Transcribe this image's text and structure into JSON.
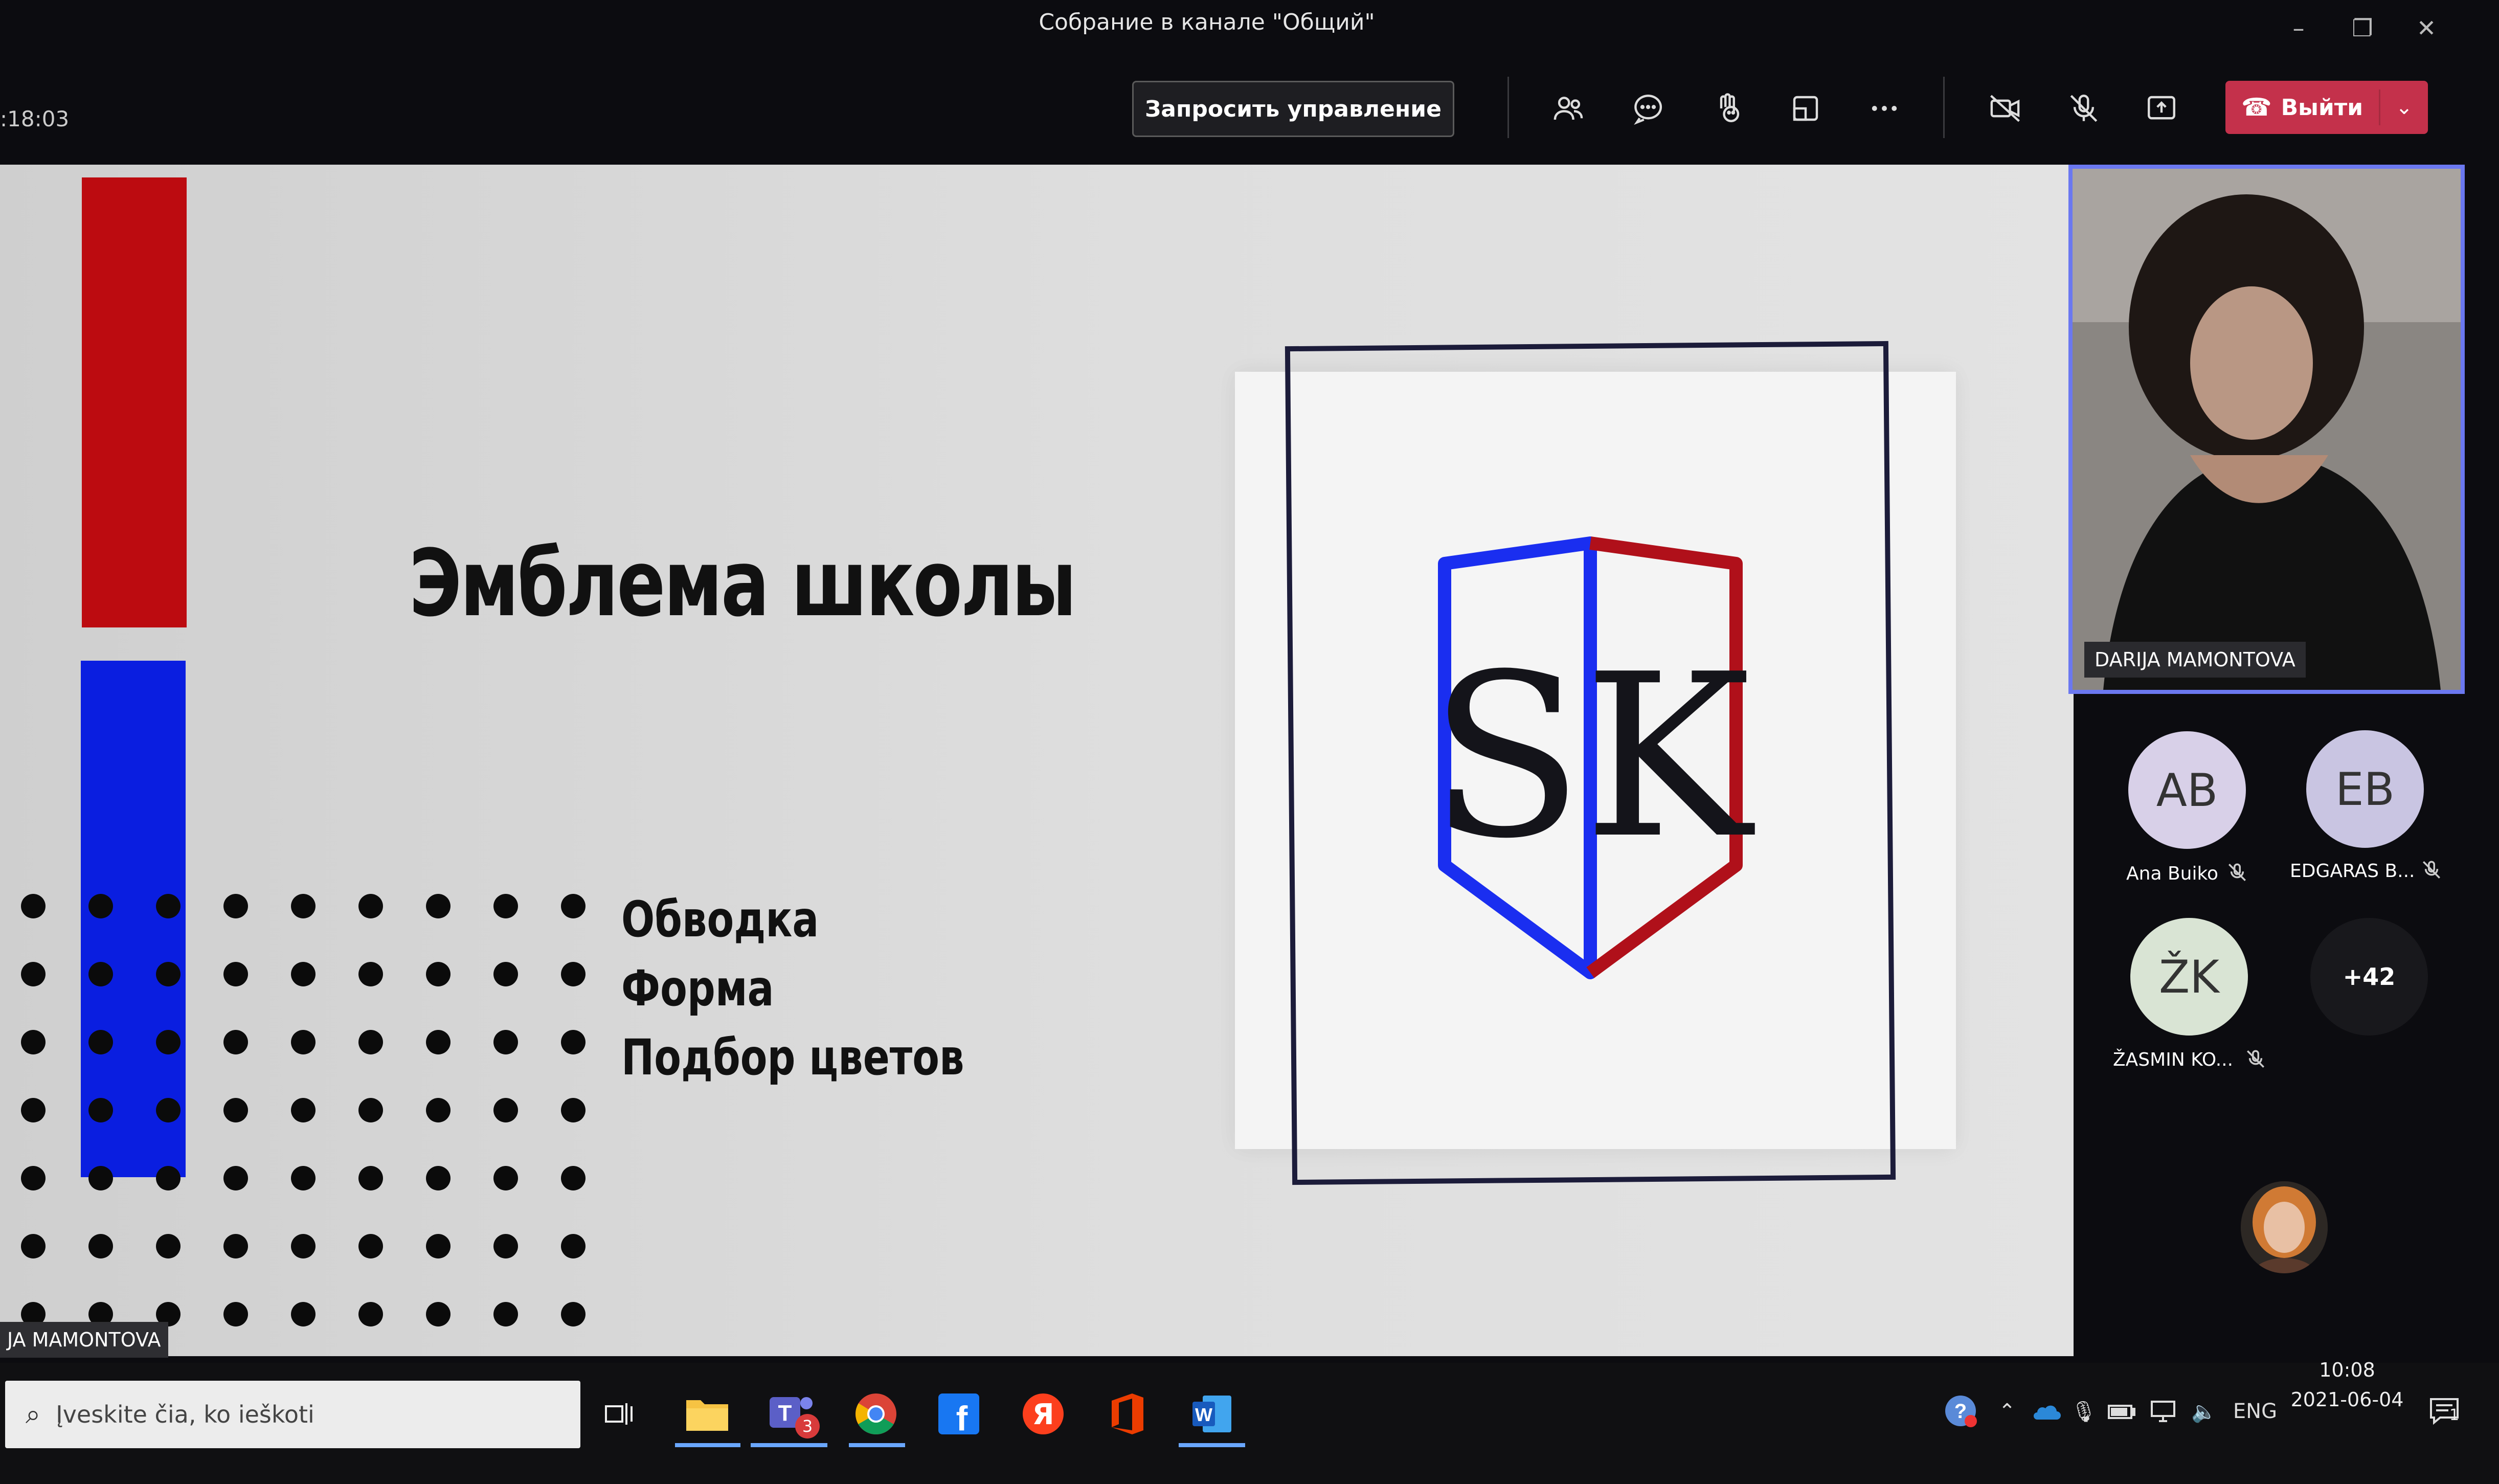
{
  "window": {
    "title": "Собрание в канале \"Общий\"",
    "timer": ":18:03"
  },
  "toolbar": {
    "request_control_label": "Запросить управление",
    "leave_label": "Выйти"
  },
  "slide": {
    "title": "Эмблема школы",
    "bullets": [
      "Обводка",
      "Форма",
      "Подбор цветов"
    ],
    "logo_letters": "SK",
    "presenter_label": "JA MAMONTOVA",
    "colors": {
      "red": "#bc0b10",
      "blue": "#0a1ee0"
    }
  },
  "video": {
    "participant_name": "DARIJA MAMONTOVA"
  },
  "participants": [
    {
      "initials": "AB",
      "name": "Ana Buiko",
      "color": "#d8d0e8"
    },
    {
      "initials": "EB",
      "name": "EDGARAS B...",
      "color": "#c9c5e2"
    },
    {
      "initials": "ŽK",
      "name": "ŽASMIN KO...",
      "color": "#d9e4d4"
    }
  ],
  "more_participants": "+42",
  "taskbar": {
    "search_placeholder": "Įveskite čia, ko ieškoti",
    "teams_badge": "3",
    "language": "ENG",
    "time": "10:08",
    "date": "2021-06-04",
    "notification_count": "1"
  }
}
